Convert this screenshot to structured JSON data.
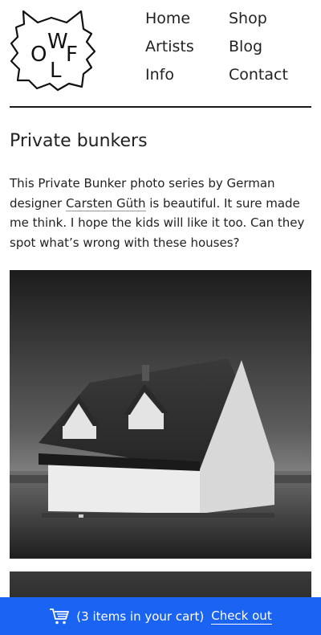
{
  "header": {
    "logo_letters": [
      "O",
      "W",
      "L",
      "F"
    ],
    "nav": [
      "Home",
      "Shop",
      "Artists",
      "Blog",
      "Info",
      "Contact"
    ]
  },
  "article": {
    "title": "Private bunkers",
    "intro_before": "This Private Bunker photo series by German designer ",
    "author_link": "Carsten Güth",
    "intro_after": " is beautiful. It sure made me think. I hope the kids will like it too. Can they spot what’s wrong with these houses?"
  },
  "cart": {
    "icon": "cart-icon",
    "summary": "(3 items in your cart)",
    "checkout_label": "Check out"
  },
  "colors": {
    "cart_bar": "#1b63f2",
    "text": "#222222"
  }
}
